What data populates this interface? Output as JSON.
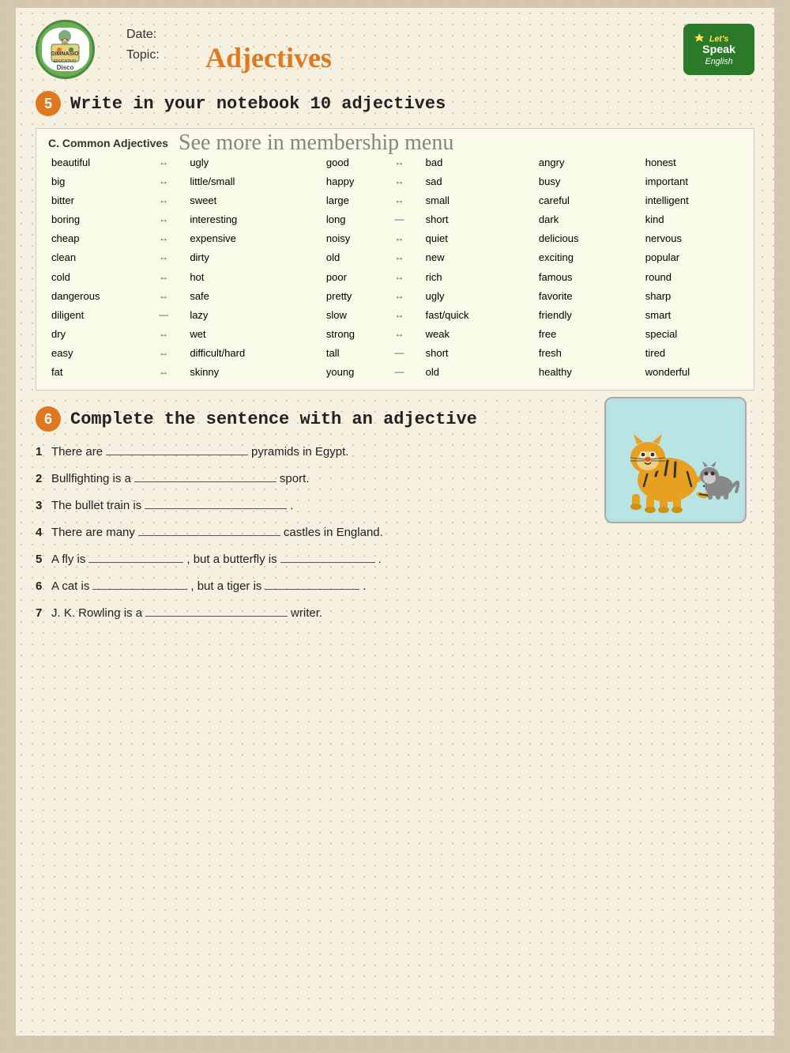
{
  "header": {
    "date_label": "Date:",
    "topic_label": "Topic:",
    "title": "Adjectives",
    "logo_left_text": "GIMNASIO EDUCATIVO",
    "logo_right_line1": "Let's",
    "logo_right_line2": "Speak",
    "logo_right_line3": "English"
  },
  "section5": {
    "number": "5",
    "text": "Write in your notebook 10 adjectives"
  },
  "table": {
    "header": "C. Common Adjectives",
    "membership_text": "See more in membership menu",
    "columns": [
      {
        "pairs": [
          {
            "word1": "beautiful",
            "arrow": "↔",
            "word2": "ugly"
          },
          {
            "word1": "big",
            "arrow": "↔",
            "word2": "little/small"
          },
          {
            "word1": "bitter",
            "arrow": "↔",
            "word2": "sweet"
          },
          {
            "word1": "boring",
            "arrow": "↔",
            "word2": "interesting"
          },
          {
            "word1": "cheap",
            "arrow": "↔",
            "word2": "expensive"
          },
          {
            "word1": "clean",
            "arrow": "↔",
            "word2": "dirty"
          },
          {
            "word1": "cold",
            "arrow": "↔",
            "word2": "hot"
          },
          {
            "word1": "dangerous",
            "arrow": "↔",
            "word2": "safe"
          },
          {
            "word1": "diligent",
            "arrow": "—",
            "word2": "lazy"
          },
          {
            "word1": "dry",
            "arrow": "↔",
            "word2": "wet"
          },
          {
            "word1": "easy",
            "arrow": "↔",
            "word2": "difficult/hard"
          },
          {
            "word1": "fat",
            "arrow": "↔",
            "word2": "skinny"
          }
        ]
      },
      {
        "pairs": [
          {
            "word1": "good",
            "arrow": "↔",
            "word2": "bad"
          },
          {
            "word1": "happy",
            "arrow": "↔",
            "word2": "sad"
          },
          {
            "word1": "large",
            "arrow": "↔",
            "word2": "small"
          },
          {
            "word1": "long",
            "arrow": "—",
            "word2": "short"
          },
          {
            "word1": "noisy",
            "arrow": "↔",
            "word2": "quiet"
          },
          {
            "word1": "old",
            "arrow": "↔",
            "word2": "new"
          },
          {
            "word1": "poor",
            "arrow": "↔",
            "word2": "rich"
          },
          {
            "word1": "pretty",
            "arrow": "↔",
            "word2": "ugly"
          },
          {
            "word1": "slow",
            "arrow": "↔",
            "word2": "fast/quick"
          },
          {
            "word1": "strong",
            "arrow": "↔",
            "word2": "weak"
          },
          {
            "word1": "tall",
            "arrow": "—",
            "word2": "short"
          },
          {
            "word1": "young",
            "arrow": "—",
            "word2": "old"
          }
        ]
      },
      {
        "col3": [
          "angry",
          "busy",
          "careful",
          "dark",
          "delicious",
          "exciting",
          "famous",
          "favorite",
          "friendly",
          "free",
          "fresh",
          "healthy"
        ],
        "col4": [
          "honest",
          "important",
          "intelligent",
          "kind",
          "nervous",
          "popular",
          "round",
          "sharp",
          "smart",
          "special",
          "tired",
          "wonderful"
        ]
      }
    ]
  },
  "section6": {
    "number": "6",
    "text": "Complete the sentence with an adjective",
    "sentences": [
      {
        "num": "1",
        "before": "There are",
        "blank": true,
        "after": "pyramids in Egypt."
      },
      {
        "num": "2",
        "before": "Bullfighting is a",
        "blank": true,
        "after": "sport."
      },
      {
        "num": "3",
        "before": "The bullet train is",
        "blank": true,
        "after": "."
      },
      {
        "num": "4",
        "before": "There are many",
        "blank": true,
        "after": "castles in England."
      },
      {
        "num": "5",
        "before": "A fly is",
        "blank": true,
        "middle": "but a butterfly is",
        "blank2": true,
        "after": "."
      },
      {
        "num": "6",
        "before": "A cat is",
        "blank": true,
        "middle": "but a tiger is",
        "blank2": true,
        "after": "."
      },
      {
        "num": "7",
        "before": "J. K. Rowling is a",
        "blank": true,
        "after": "writer."
      }
    ]
  }
}
